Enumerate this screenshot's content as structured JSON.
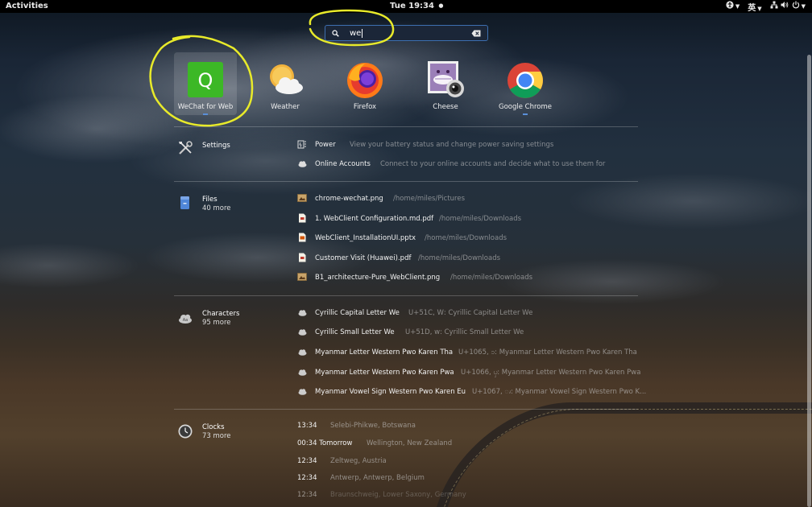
{
  "topbar": {
    "activities": "Activities",
    "clock": "Tue 19:34",
    "clock_indicator": "●",
    "input_method": "英"
  },
  "search": {
    "value": "we"
  },
  "apps": [
    {
      "label": "WeChat for Web",
      "icon": "wechat-q-icon",
      "color": "#3cb826"
    },
    {
      "label": "Weather",
      "icon": "weather-icon"
    },
    {
      "label": "Firefox",
      "icon": "firefox-icon"
    },
    {
      "label": "Cheese",
      "icon": "cheese-icon"
    },
    {
      "label": "Google Chrome",
      "icon": "chrome-icon"
    }
  ],
  "settings": {
    "provider": "Settings",
    "results": [
      {
        "name": "Power",
        "desc": "View your battery status and change power saving settings"
      },
      {
        "name": "Online Accounts",
        "desc": "Connect to your online accounts and decide what to use them for"
      }
    ]
  },
  "files": {
    "provider": "Files",
    "more": "40 more",
    "results": [
      {
        "name": "chrome-wechat.png",
        "desc": "/home/miles/Pictures"
      },
      {
        "name": "1. WebClient Configuration.md.pdf",
        "desc": "/home/miles/Downloads"
      },
      {
        "name": "WebClient_InstallationUI.pptx",
        "desc": "/home/miles/Downloads"
      },
      {
        "name": "Customer Visit (Huawei).pdf",
        "desc": "/home/miles/Downloads"
      },
      {
        "name": "B1_architecture-Pure_WebClient.png",
        "desc": "/home/miles/Downloads"
      }
    ]
  },
  "characters": {
    "provider": "Characters",
    "more": "95 more",
    "results": [
      {
        "name": "Cyrillic Capital Letter We",
        "desc": "U+51C, Ԝ: Cyrillic Capital Letter We"
      },
      {
        "name": "Cyrillic Small Letter We",
        "desc": "U+51D, ԝ: Cyrillic Small Letter We"
      },
      {
        "name": "Myanmar Letter Western Pwo Karen Tha",
        "desc": "U+1065, ၥ: Myanmar Letter Western Pwo Karen Tha"
      },
      {
        "name": "Myanmar Letter Western Pwo Karen Pwa",
        "desc": "U+1066, ၦ: Myanmar Letter Western Pwo Karen Pwa"
      },
      {
        "name": "Myanmar Vowel Sign Western Pwo Karen Eu",
        "desc": "U+1067, ၧ: Myanmar Vowel Sign Western Pwo K..."
      }
    ]
  },
  "clocks": {
    "provider": "Clocks",
    "more": "73 more",
    "results": [
      {
        "name": "13:34",
        "desc": "Selebi-Phikwe, Botswana"
      },
      {
        "name": "00:34 Tomorrow",
        "desc": "Wellington, New Zealand"
      },
      {
        "name": "12:34",
        "desc": "Zeltweg, Austria"
      },
      {
        "name": "12:34",
        "desc": "Antwerp, Antwerp, Belgium"
      },
      {
        "name": "12:34",
        "desc": "Braunschweig, Lower Saxony, Germany"
      }
    ]
  },
  "colors": {
    "annotation": "#e8ea2a",
    "accent": "#3d6fb0"
  }
}
